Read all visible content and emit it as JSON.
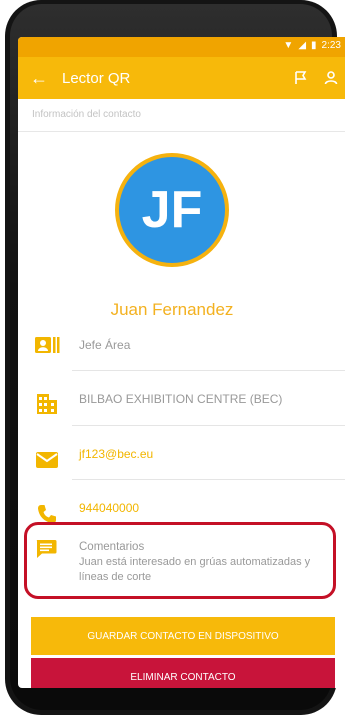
{
  "status_bar": {
    "time": "2:23"
  },
  "app_bar": {
    "title": "Lector QR",
    "back_icon": "back-arrow-icon",
    "actions": [
      "flag-icon",
      "person-icon"
    ]
  },
  "section_header": "Información del contacto",
  "contact": {
    "initials": "JF",
    "name": "Juan Fernandez",
    "rows": [
      {
        "icon": "id-card-icon",
        "value": "Jefe Área"
      },
      {
        "icon": "building-icon",
        "value": "BILBAO EXHIBITION CENTRE (BEC)"
      },
      {
        "icon": "mail-icon",
        "value": "jf123@bec.eu"
      },
      {
        "icon": "phone-icon",
        "value": "944040000"
      }
    ],
    "comments_label": "Comentarios",
    "comments_text": "Juan está interesado en grúas automatizadas y líneas de corte"
  },
  "buttons": {
    "save": "GUARDAR CONTACTO EN DISPOSITIVO",
    "delete": "ELIMINAR CONTACTO"
  },
  "colors": {
    "primary": "#f7b90a",
    "status_bar": "#f0a400",
    "danger": "#c8143a",
    "avatar": "#2e95e2",
    "highlight_border": "#c41026"
  }
}
